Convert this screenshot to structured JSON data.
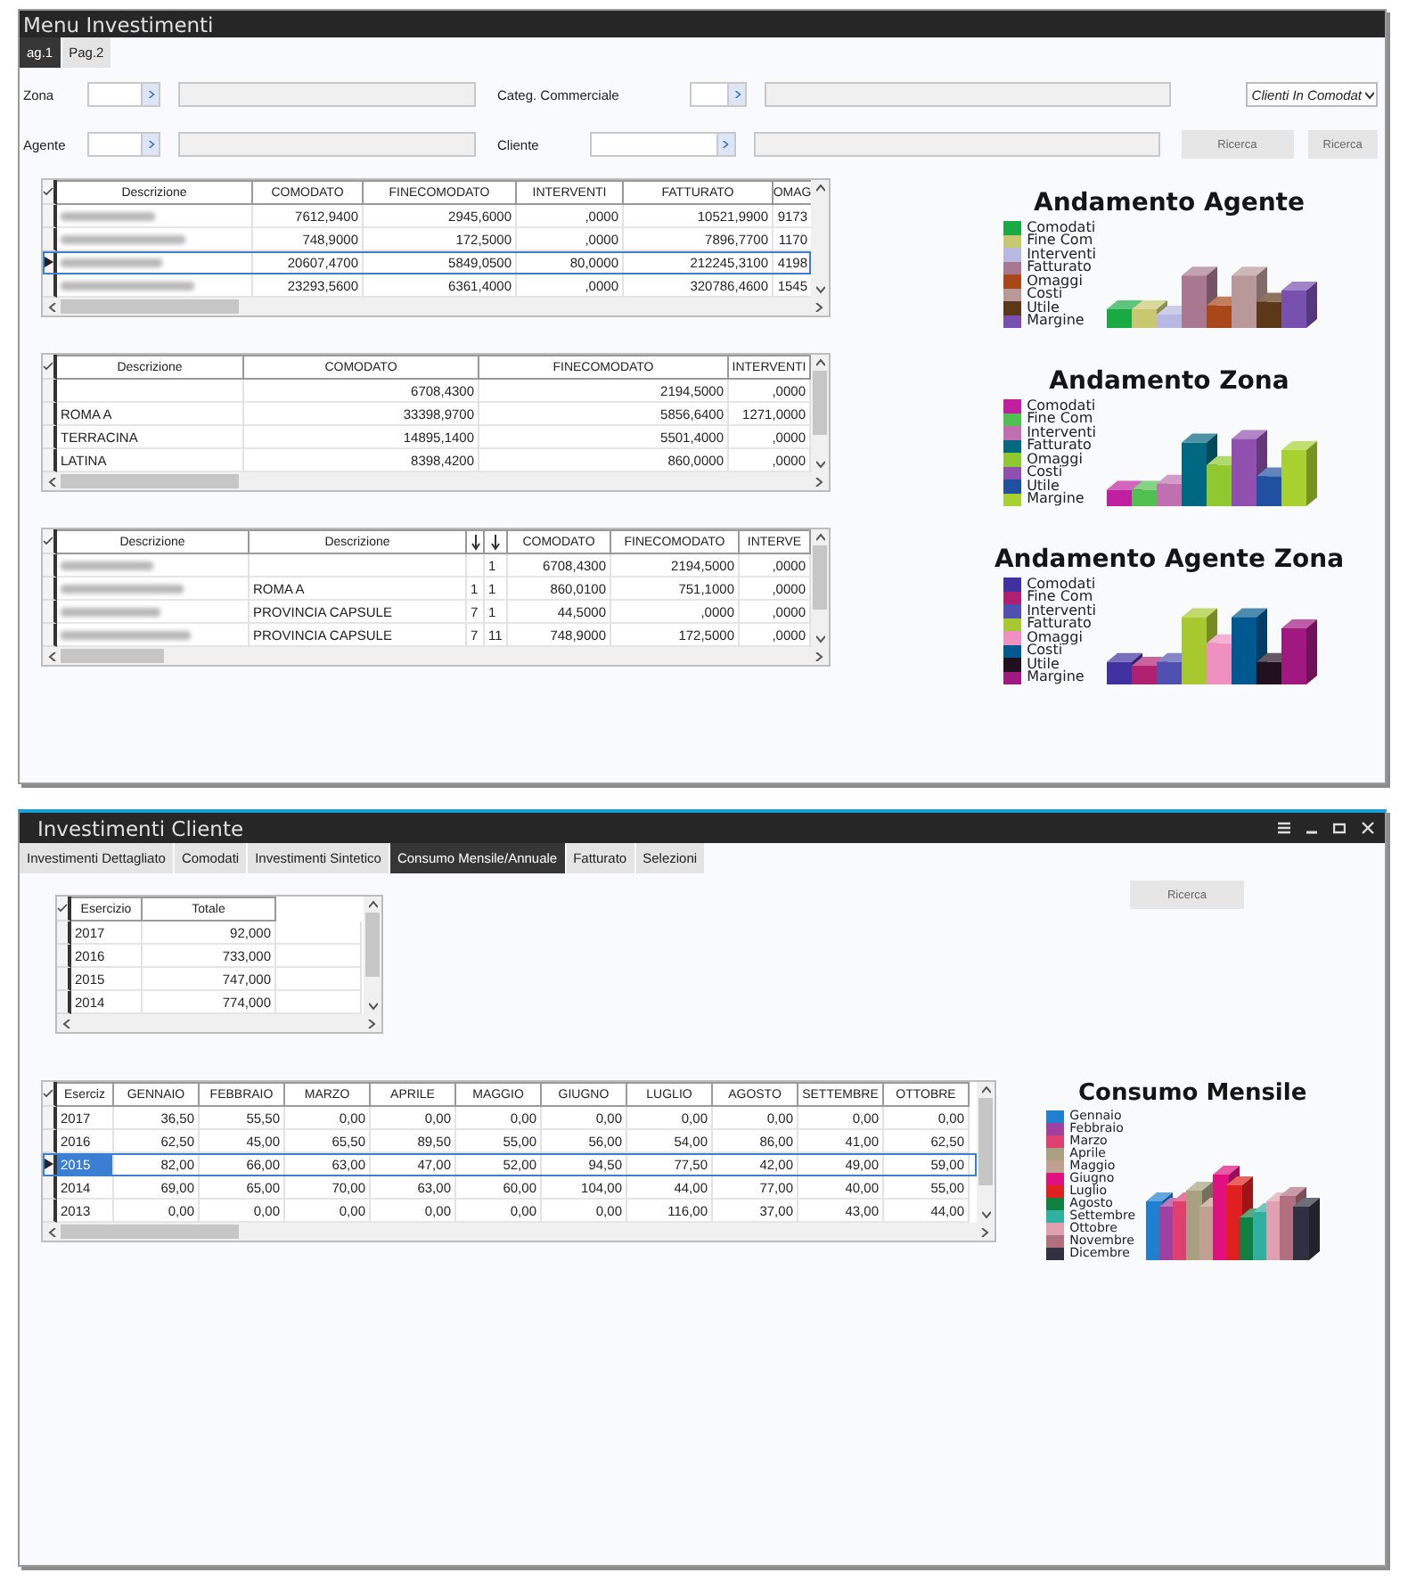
{
  "menu_investimenti": {
    "title": "Menu Investimenti",
    "tabs": [
      {
        "label": "ag.1",
        "selected": true
      },
      {
        "label": "Pag.2",
        "selected": false
      }
    ],
    "filters": [
      {
        "label": "Zona",
        "kind": "short"
      },
      {
        "label": "Categ. Commerciale",
        "kind": "short"
      },
      {
        "label": "Agente",
        "kind": "short"
      },
      {
        "label": "Cliente",
        "kind": "long"
      }
    ],
    "dropdown": {
      "value": "Clienti In Comodat"
    },
    "buttons": [
      "Ricerca",
      "Ricerca"
    ],
    "grids": [
      {
        "columns": [
          "Descrizione",
          "COMODATO",
          "FINECOMODATO",
          "INTERVENTI",
          "FATTURATO",
          "OMAG"
        ],
        "rows": [
          {
            "blurred": true,
            "selected": false,
            "cells": [
              "",
              "7612,9400",
              "2945,6000",
              ",0000",
              "10521,9900",
              "9173"
            ]
          },
          {
            "blurred": true,
            "selected": false,
            "cells": [
              "",
              "748,9000",
              "172,5000",
              ",0000",
              "7896,7700",
              "1170"
            ]
          },
          {
            "blurred": true,
            "selected": true,
            "cells": [
              "",
              "20607,4700",
              "5849,0500",
              "80,0000",
              "212245,3100",
              "4198"
            ]
          },
          {
            "blurred": true,
            "selected": false,
            "cells": [
              "",
              "23293,5600",
              "6361,4000",
              ",0000",
              "320786,4600",
              "1545"
            ]
          }
        ]
      },
      {
        "columns": [
          "Descrizione",
          "COMODATO",
          "FINECOMODATO",
          "INTERVENTI"
        ],
        "rows": [
          {
            "blurred": false,
            "selected": false,
            "cells": [
              "",
              "6708,4300",
              "2194,5000",
              ",0000"
            ]
          },
          {
            "blurred": false,
            "selected": false,
            "cells": [
              "ROMA A",
              "33398,9700",
              "5856,6400",
              "1271,0000"
            ]
          },
          {
            "blurred": false,
            "selected": false,
            "cells": [
              "TERRACINA",
              "14895,1400",
              "5501,4000",
              ",0000"
            ]
          },
          {
            "blurred": false,
            "selected": false,
            "cells": [
              "LATINA",
              "8398,4200",
              "860,0000",
              ",0000"
            ]
          }
        ]
      },
      {
        "columns": [
          "Descrizione",
          "Descrizione",
          null,
          null,
          "COMODATO",
          "FINECOMODATO",
          "INTERVE"
        ],
        "rows": [
          {
            "blurred": true,
            "selected": false,
            "cells": [
              "",
              "",
              "",
              "1",
              "6708,4300",
              "2194,5000",
              ",0000"
            ]
          },
          {
            "blurred": true,
            "selected": false,
            "cells": [
              "",
              "ROMA A",
              "1",
              "1",
              "860,0100",
              "751,1000",
              ",0000"
            ]
          },
          {
            "blurred": true,
            "selected": false,
            "cells": [
              "",
              "PROVINCIA CAPSULE",
              "7",
              "1",
              "44,5000",
              ",0000",
              ",0000"
            ]
          },
          {
            "blurred": true,
            "selected": false,
            "cells": [
              "",
              "PROVINCIA CAPSULE",
              "7",
              "11",
              "748,9000",
              "172,5000",
              ",0000"
            ]
          }
        ]
      }
    ],
    "charts": [
      {
        "title": "Andamento Agente",
        "legend": [
          {
            "label": "Comodati",
            "color": "#1aaa44"
          },
          {
            "label": "Fine Com",
            "color": "#c8c870"
          },
          {
            "label": "Interventi",
            "color": "#b8b8e0"
          },
          {
            "label": "Fatturato",
            "color": "#a87890"
          },
          {
            "label": "Omaggi",
            "color": "#a84818"
          },
          {
            "label": "Costi",
            "color": "#b89898"
          },
          {
            "label": "Utile",
            "color": "#5a3818"
          },
          {
            "label": "Margine",
            "color": "#7850b0"
          }
        ]
      },
      {
        "title": "Andamento Zona",
        "legend": [
          {
            "label": "Comodati",
            "color": "#c020a0"
          },
          {
            "label": "Fine Com",
            "color": "#50c050"
          },
          {
            "label": "Interventi",
            "color": "#c070b0"
          },
          {
            "label": "Fatturato",
            "color": "#006880"
          },
          {
            "label": "Omaggi",
            "color": "#90c830"
          },
          {
            "label": "Costi",
            "color": "#9050b0"
          },
          {
            "label": "Utile",
            "color": "#2050a0"
          },
          {
            "label": "Margine",
            "color": "#a8d030"
          }
        ]
      },
      {
        "title": "Andamento Agente Zona",
        "legend": [
          {
            "label": "Comodati",
            "color": "#4030a0"
          },
          {
            "label": "Fine Com",
            "color": "#b02070"
          },
          {
            "label": "Interventi",
            "color": "#5050b0"
          },
          {
            "label": "Fatturato",
            "color": "#a8c830"
          },
          {
            "label": "Omaggi",
            "color": "#f090c0"
          },
          {
            "label": "Costi",
            "color": "#005890"
          },
          {
            "label": "Utile",
            "color": "#201020"
          },
          {
            "label": "Margine",
            "color": "#a01880"
          }
        ]
      }
    ]
  },
  "investimenti_cliente": {
    "title": "Investimenti Cliente",
    "tabs": [
      {
        "label": "Investimenti Dettagliato",
        "selected": false
      },
      {
        "label": "Comodati",
        "selected": false
      },
      {
        "label": "Investimenti Sintetico",
        "selected": false
      },
      {
        "label": "Consumo Mensile/Annuale",
        "selected": true
      },
      {
        "label": "Fatturato",
        "selected": false
      },
      {
        "label": "Selezioni",
        "selected": false
      }
    ],
    "button": "Ricerca",
    "totals_grid": {
      "columns": [
        "Esercizio",
        "Totale"
      ],
      "rows": [
        {
          "selected": false,
          "cells": [
            "2017",
            "92,000"
          ]
        },
        {
          "selected": false,
          "cells": [
            "2016",
            "733,000"
          ]
        },
        {
          "selected": false,
          "cells": [
            "2015",
            "747,000"
          ]
        },
        {
          "selected": false,
          "cells": [
            "2014",
            "774,000"
          ]
        }
      ]
    },
    "monthly_grid": {
      "columns": [
        "Eserciz",
        "GENNAIO",
        "FEBBRAIO",
        "MARZO",
        "APRILE",
        "MAGGIO",
        "GIUGNO",
        "LUGLIO",
        "AGOSTO",
        "SETTEMBRE",
        "OTTOBRE"
      ],
      "rows": [
        {
          "selected": false,
          "cells": [
            "2017",
            "36,50",
            "55,50",
            "0,00",
            "0,00",
            "0,00",
            "0,00",
            "0,00",
            "0,00",
            "0,00",
            "0,00"
          ]
        },
        {
          "selected": false,
          "cells": [
            "2016",
            "62,50",
            "45,00",
            "65,50",
            "89,50",
            "55,00",
            "56,00",
            "54,00",
            "86,00",
            "41,00",
            "62,50"
          ]
        },
        {
          "selected": true,
          "cells": [
            "2015",
            "82,00",
            "66,00",
            "63,00",
            "47,00",
            "52,00",
            "94,50",
            "77,50",
            "42,00",
            "49,00",
            "59,00"
          ]
        },
        {
          "selected": false,
          "cells": [
            "2014",
            "69,00",
            "65,00",
            "70,00",
            "63,00",
            "60,00",
            "104,00",
            "44,00",
            "77,00",
            "40,00",
            "55,00"
          ]
        },
        {
          "selected": false,
          "cells": [
            "2013",
            "0,00",
            "0,00",
            "0,00",
            "0,00",
            "0,00",
            "0,00",
            "116,00",
            "37,00",
            "43,00",
            "44,00"
          ]
        }
      ]
    },
    "chart": {
      "title": "Consumo Mensile",
      "legend": [
        {
          "label": "Gennaio",
          "color": "#2080d0"
        },
        {
          "label": "Febbraio",
          "color": "#a040a0"
        },
        {
          "label": "Marzo",
          "color": "#e04070"
        },
        {
          "label": "Aprile",
          "color": "#a8a080"
        },
        {
          "label": "Maggio",
          "color": "#c0a090"
        },
        {
          "label": "Giugno",
          "color": "#e01080"
        },
        {
          "label": "Luglio",
          "color": "#e02020"
        },
        {
          "label": "Agosto",
          "color": "#108040"
        },
        {
          "label": "Settembre",
          "color": "#30b0a0"
        },
        {
          "label": "Ottobre",
          "color": "#e0a0b0"
        },
        {
          "label": "Novembre",
          "color": "#b07080"
        },
        {
          "label": "Dicembre",
          "color": "#303040"
        }
      ]
    }
  }
}
